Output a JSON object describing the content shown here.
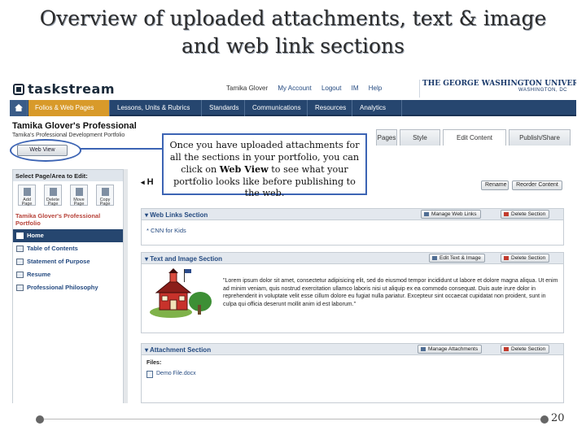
{
  "slide": {
    "title_line1": "Overview of uploaded attachments, text & image",
    "title_line2": "and web link sections",
    "page_number": "20"
  },
  "app": {
    "logo_text": "taskstream",
    "top_links": [
      "Tamika Glover",
      "My Account",
      "Logout",
      "IM",
      "Help"
    ],
    "university_name": "THE GEORGE WASHINGTON UNIVERSITY",
    "university_location": "WASHINGTON, DC",
    "nav": [
      "Folios & Web Pages",
      "Lessons, Units & Rubrics",
      "Standards",
      "Communications",
      "Resources",
      "Analytics"
    ],
    "active_nav": "Folios & Web Pages",
    "page_heading": "Tamika Glover's Professional",
    "page_subheading": "Tamika's Professional Development Portfolio",
    "web_view_label": "Web View",
    "tabs": [
      "Pages",
      "Style",
      "Edit Content",
      "Publish/Share"
    ],
    "active_tab": "Edit Content",
    "main_header": "H",
    "rename_label": "Rename",
    "reorder_label": "Reorder Content"
  },
  "sidebar": {
    "header": "Select Page/Area to Edit:",
    "icon_buttons": [
      "Add Page",
      "Delete Page",
      "Move Page",
      "Copy Page"
    ],
    "portfolio_title": "Tamika Glover's Professional Portfolio",
    "items": [
      {
        "label": "Home",
        "selected": true
      },
      {
        "label": "Table of Contents",
        "selected": false
      },
      {
        "label": "Statement of Purpose",
        "selected": false
      },
      {
        "label": "Resume",
        "selected": false
      },
      {
        "label": "Professional Philosophy",
        "selected": false
      }
    ]
  },
  "sections": {
    "web_links": {
      "title": "Web Links Section",
      "manage_label": "Manage Web Links",
      "delete_label": "Delete Section",
      "link_text": "CNN for Kids"
    },
    "text_image": {
      "title": "Text and Image Section",
      "edit_label": "Edit Text & Image",
      "delete_label": "Delete Section",
      "body": "\"Lorem ipsum dolor sit amet, consectetur adipisicing elit, sed do eiusmod tempor incididunt ut labore et dolore magna aliqua. Ut enim ad minim veniam, quis nostrud exercitation ullamco laboris nisi ut aliquip ex ea commodo consequat. Duis aute irure dolor in reprehenderit in voluptate velit esse cillum dolore eu fugiat nulla pariatur. Excepteur sint occaecat cupidatat non proident, sunt in culpa qui officia deserunt mollit anim id est laborum.\""
    },
    "attachments": {
      "title": "Attachment Section",
      "manage_label": "Manage Attachments",
      "delete_label": "Delete Section",
      "files_label": "Files:",
      "file_name": "Demo File.docx"
    }
  },
  "callout": {
    "text_before": "Once you have uploaded attachments for all the sections in your portfolio, you can click on ",
    "text_bold": "Web View",
    "text_after": " to see what your portfolio looks like before publishing to the web."
  },
  "colors": {
    "nav_bg": "#26466f",
    "active_nav": "#d89a2a",
    "highlight": "#3c64b4",
    "portfolio_title": "#b7433a"
  }
}
